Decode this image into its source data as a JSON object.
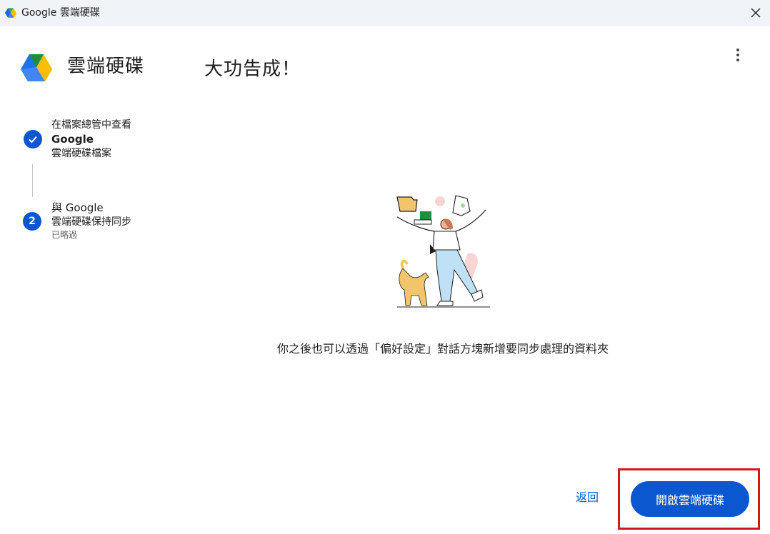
{
  "window": {
    "title": "Google 雲端硬碟",
    "close_icon": "close-icon"
  },
  "header": {
    "brand": "雲端硬碟",
    "heading": "大功告成！",
    "menu_icon": "more-vert-icon"
  },
  "steps": [
    {
      "status": "completed",
      "icon": "check-icon",
      "line1": "在檔案總管中查看",
      "line2": "Google",
      "line3": "雲端硬碟檔案"
    },
    {
      "status": "skipped",
      "number": "2",
      "line1": "與 Google",
      "line2": "雲端硬碟保持同步",
      "line3": "已略過"
    }
  ],
  "main": {
    "illustration": "person-juggling-files-with-cat-illustration",
    "message": "你之後也可以透過「偏好設定」對話方塊新增要同步處理的資料夾"
  },
  "footer": {
    "back_label": "返回",
    "open_label": "開啟雲端硬碟"
  },
  "colors": {
    "primary": "#0b57d0",
    "titlebar_bg": "#f0f4f9",
    "highlight_border": "#d4161e"
  }
}
